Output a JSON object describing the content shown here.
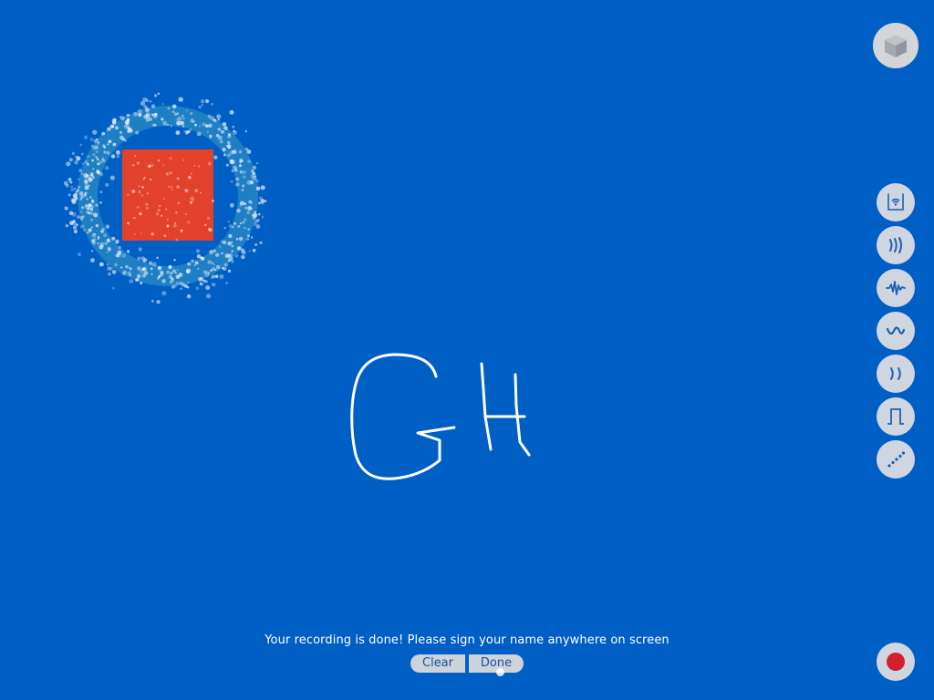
{
  "message": "Your recording is done! Please sign your name anywhere on screen",
  "buttons": {
    "clear": "Clear",
    "done": "Done"
  },
  "toolbar": {
    "top": {
      "icon": "cube-icon"
    },
    "tools": [
      {
        "icon": "wifi-box-icon"
      },
      {
        "icon": "sound-waves-icon"
      },
      {
        "icon": "waveform-icon"
      },
      {
        "icon": "sine-wave-icon"
      },
      {
        "icon": "parentheses-icon"
      },
      {
        "icon": "square-wave-icon"
      },
      {
        "icon": "dotted-line-icon"
      }
    ],
    "record": {
      "icon": "record-icon"
    }
  },
  "colors": {
    "background": "#005fc4",
    "shape": "#e2412a",
    "record": "#d21f2b",
    "button": "#cdd3db"
  },
  "signature_text": "GH"
}
